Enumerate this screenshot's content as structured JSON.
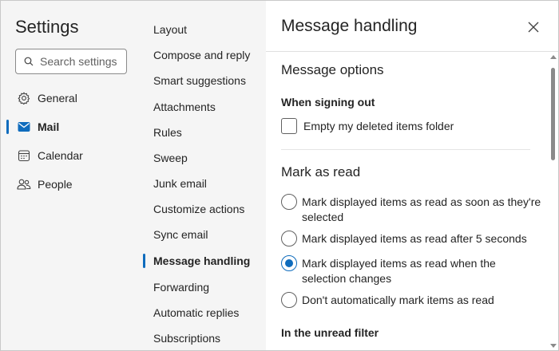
{
  "app": {
    "title": "Settings",
    "search_placeholder": "Search settings"
  },
  "nav": {
    "items": [
      {
        "label": "General",
        "icon": "gear-icon"
      },
      {
        "label": "Mail",
        "icon": "mail-icon"
      },
      {
        "label": "Calendar",
        "icon": "calendar-icon"
      },
      {
        "label": "People",
        "icon": "people-icon"
      }
    ],
    "selected": "Mail"
  },
  "mail_sections": {
    "items": [
      "Layout",
      "Compose and reply",
      "Smart suggestions",
      "Attachments",
      "Rules",
      "Sweep",
      "Junk email",
      "Customize actions",
      "Sync email",
      "Message handling",
      "Forwarding",
      "Automatic replies",
      "Subscriptions"
    ],
    "selected": "Message handling"
  },
  "panel": {
    "title": "Message handling",
    "message_options": {
      "title": "Message options",
      "signing_out_title": "When signing out",
      "empty_deleted_label": "Empty my deleted items folder",
      "empty_deleted_checked": false
    },
    "mark_as_read": {
      "title": "Mark as read",
      "options": [
        {
          "label": "Mark displayed items as read as soon as they're selected",
          "checked": false
        },
        {
          "label": "Mark displayed items as read after 5 seconds",
          "checked": false
        },
        {
          "label": "Mark displayed items as read when the selection changes",
          "checked": true
        },
        {
          "label": "Don't automatically mark items as read",
          "checked": false
        }
      ]
    },
    "unread_filter_title": "In the unread filter"
  },
  "colors": {
    "accent": "#0f6cbd",
    "nav_background": "#f5f5f5",
    "text": "#242424"
  }
}
